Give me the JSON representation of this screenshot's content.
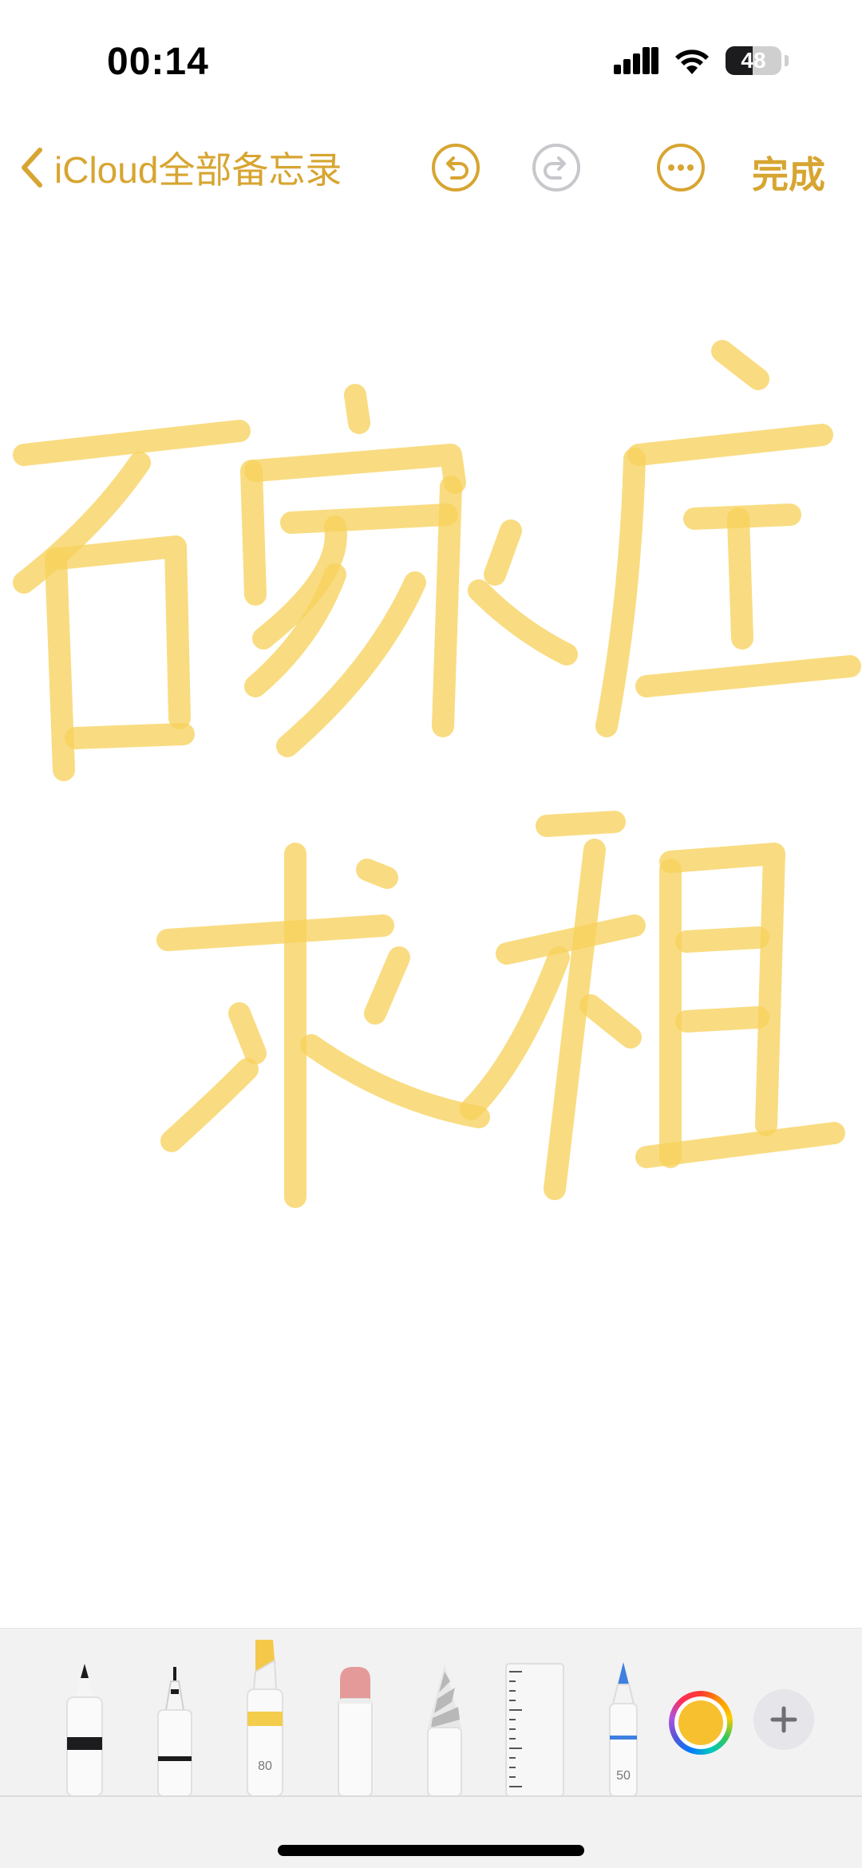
{
  "status_bar": {
    "time": "00:14",
    "battery_level": "48",
    "battery_fraction": 0.48
  },
  "nav": {
    "back_label": "iCloud全部备忘录",
    "done_label": "完成",
    "accent_color": "#d7a531"
  },
  "icons": {
    "back": "chevron-left-icon",
    "undo": "undo-icon",
    "redo": "redo-icon",
    "more": "ellipsis-circle-icon",
    "add": "plus-icon"
  },
  "canvas": {
    "ink_color": "#f7d25e",
    "handwriting_lines": [
      "石家庄",
      "求租"
    ]
  },
  "tools": {
    "highlighter_size": "80",
    "pencil_size": "50",
    "selected_color": "#f6c02f",
    "items": [
      "pen",
      "fineliner",
      "highlighter",
      "eraser",
      "lasso",
      "ruler",
      "pencil"
    ]
  }
}
